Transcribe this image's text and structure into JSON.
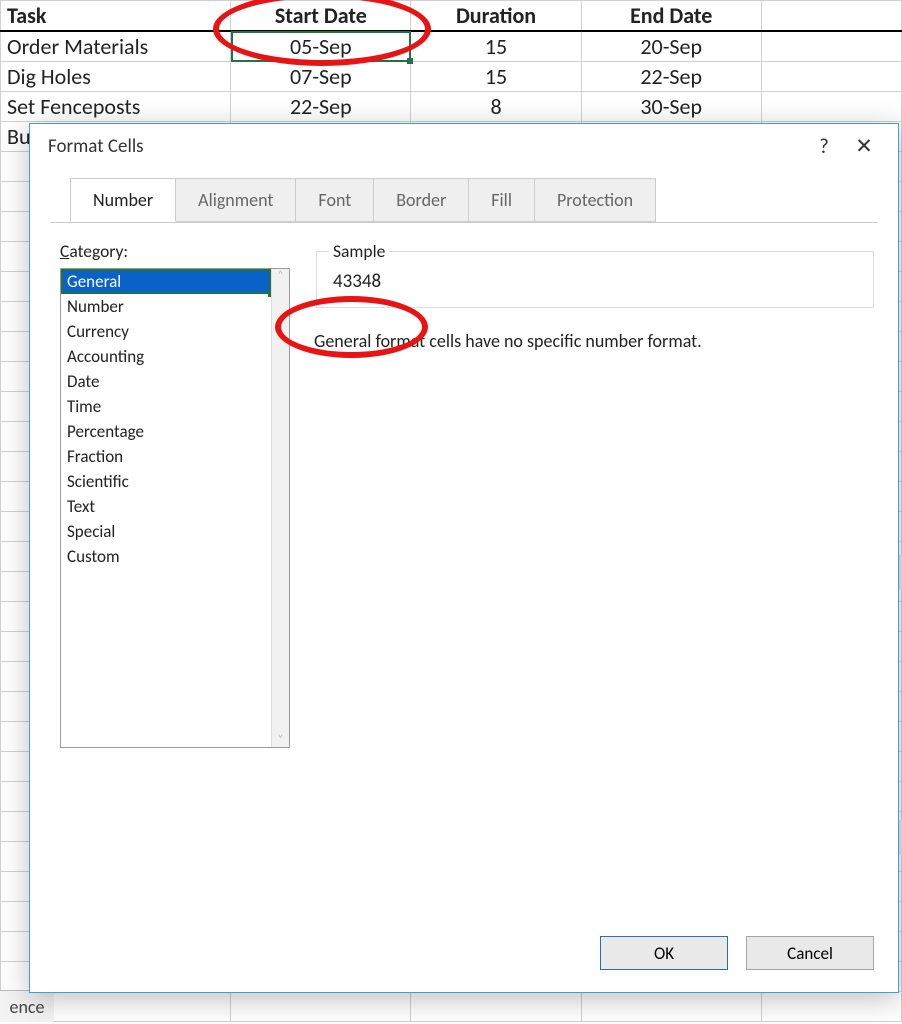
{
  "sheet": {
    "headers": [
      "Task",
      "Start Date",
      "Duration",
      "End Date"
    ],
    "rows": [
      {
        "task": "Order Materials",
        "start": "05-Sep",
        "duration": "15",
        "end": "20-Sep"
      },
      {
        "task": "Dig Holes",
        "start": "07-Sep",
        "duration": "15",
        "end": "22-Sep"
      },
      {
        "task": "Set Fenceposts",
        "start": "22-Sep",
        "duration": "8",
        "end": "30-Sep"
      },
      {
        "task": "Bui",
        "start": "",
        "duration": "",
        "end": ""
      }
    ],
    "tab_partial": "ence"
  },
  "dialog": {
    "title": "Format Cells",
    "help": "?",
    "close": "✕",
    "tabs": [
      "Number",
      "Alignment",
      "Font",
      "Border",
      "Fill",
      "Protection"
    ],
    "active_tab": 0,
    "category_label_pre": "C",
    "category_label_rest": "ategory:",
    "categories": [
      "General",
      "Number",
      "Currency",
      "Accounting",
      "Date",
      "Time",
      "Percentage",
      "Fraction",
      "Scientific",
      "Text",
      "Special",
      "Custom"
    ],
    "selected_category": 0,
    "sample_label": "Sample",
    "sample_value": "43348",
    "description": "General format cells have no specific number format.",
    "scroll_up": "˄",
    "scroll_down": "˅",
    "ok": "OK",
    "cancel": "Cancel"
  }
}
